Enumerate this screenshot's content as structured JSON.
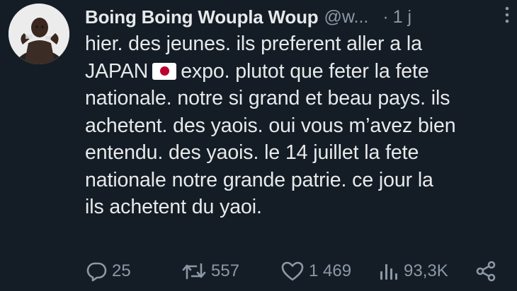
{
  "author": {
    "display_name": "Boing Boing Woupla Woup",
    "handle": "@w...",
    "separator": "·",
    "time": "1 j"
  },
  "tweet": {
    "line1": "hier. des jeunes. ils preferent aller a la",
    "line2_before_flag": "JAPAN",
    "flag": "japan-flag",
    "line2_after_flag": "expo. plutot que feter la fete",
    "line3": "nationale. notre si grand et beau pays. ils",
    "line4": "achetent. des yaois. oui vous m’avez bien",
    "line5": "entendu. des yaois. le 14 juillet la fete",
    "line6": "nationale notre grande patrie. ce jour la",
    "line7": "ils achetent du yaoi."
  },
  "actions": {
    "reply_count": "25",
    "retweet_count": "557",
    "like_count": "1 469",
    "views_count": "93,3K"
  },
  "icons": {
    "reply": "reply-bubble-icon",
    "retweet": "retweet-icon",
    "like": "heart-icon",
    "views": "views-chart-icon",
    "share": "share-icon",
    "more": "more-vertical-icon"
  },
  "colors": {
    "background": "#141d26",
    "text": "#e7e9ea",
    "muted": "#8b98a5",
    "flag_red": "#bc002d"
  }
}
